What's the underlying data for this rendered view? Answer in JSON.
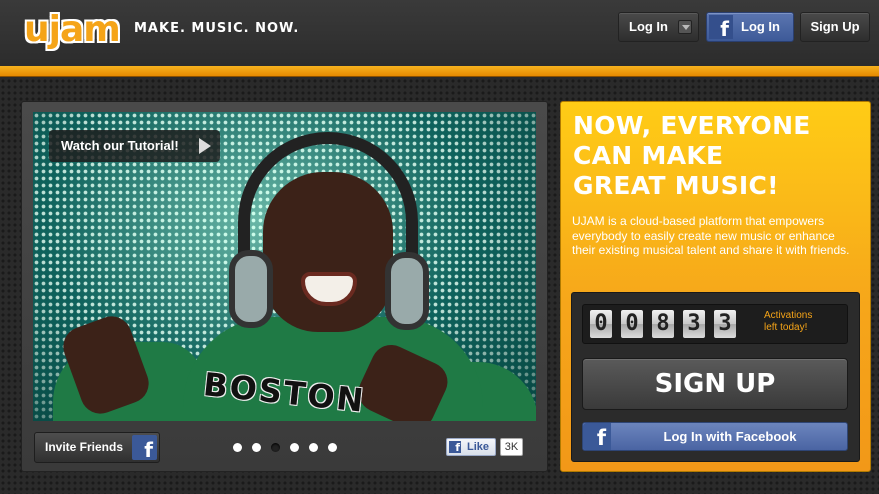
{
  "header": {
    "logo_text": "ujam",
    "tagline": "MAKE. MUSIC. NOW.",
    "login_label": "Log In",
    "fb_login_label": "Log In",
    "signup_label": "Sign Up"
  },
  "hero": {
    "tutorial_label": "Watch our Tutorial!",
    "shirt_text": "BOSTON"
  },
  "frame_bar": {
    "invite_label": "Invite Friends",
    "slide_count": 6,
    "active_slide": 3,
    "like_label": "Like",
    "like_count": "3K"
  },
  "panel": {
    "title_lines": [
      "NOW, EVERYONE",
      "CAN MAKE",
      "GREAT MUSIC!"
    ],
    "description_lines": [
      "UJAM is a cloud-based platform that empowers",
      "everybody to easily create new music or enhance",
      "their existing musical talent and share it with friends."
    ],
    "counter_digits": [
      "0",
      "0",
      "8",
      "3",
      "3"
    ],
    "activations_line1": "Activations",
    "activations_line2": "left today!",
    "signup_label": "SIGN UP",
    "fb_login_label": "Log In with Facebook"
  },
  "colors": {
    "accent_orange": "#f5a418",
    "facebook_blue": "#3b5998",
    "background_dark": "#2a2a2a"
  },
  "icons": [
    "facebook-icon",
    "play-icon",
    "dropdown-arrow-icon"
  ]
}
